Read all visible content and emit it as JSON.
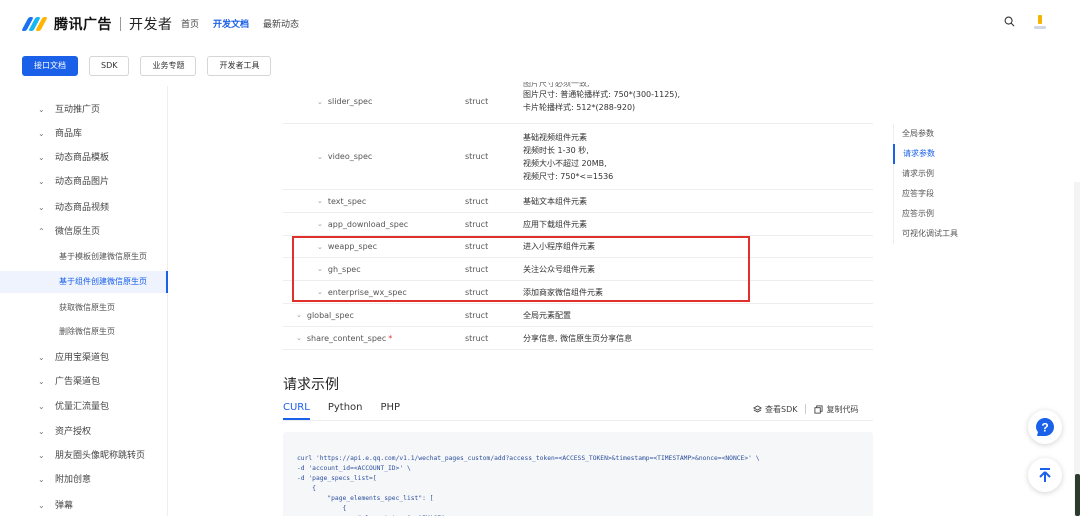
{
  "header": {
    "brand": "腾讯广告",
    "brand_sub": "开发者",
    "nav": [
      {
        "label": "首页"
      },
      {
        "label": "开发文档"
      },
      {
        "label": "最新动态"
      }
    ],
    "active_nav": "开发文档"
  },
  "subnav": {
    "pills": [
      {
        "label": "接口文档"
      },
      {
        "label": "SDK"
      },
      {
        "label": "业务专题"
      },
      {
        "label": "开发者工具"
      }
    ]
  },
  "sidebar": {
    "items": [
      {
        "label": "互动推广页",
        "chev": "⌄"
      },
      {
        "label": "商品库",
        "chev": "⌄"
      },
      {
        "label": "动态商品模板",
        "chev": "⌄"
      },
      {
        "label": "动态商品图片",
        "chev": "⌄"
      },
      {
        "label": "动态商品视频",
        "chev": "⌄"
      },
      {
        "label": "微信原生页",
        "chev": "⌃"
      },
      {
        "label": "应用宝渠道包",
        "chev": "⌄"
      },
      {
        "label": "广告渠道包",
        "chev": "⌄"
      },
      {
        "label": "优量汇流量包",
        "chev": "⌄"
      },
      {
        "label": "资产授权",
        "chev": "⌄"
      },
      {
        "label": "朋友圈头像昵称跳转页",
        "chev": "⌄"
      },
      {
        "label": "附加创意",
        "chev": "⌄"
      },
      {
        "label": "弹幕",
        "chev": "⌄"
      }
    ],
    "subitems": [
      {
        "label": "基于模板创建微信原生页"
      },
      {
        "label": "基于组件创建微信原生页"
      },
      {
        "label": "获取微信原生页"
      },
      {
        "label": "删除微信原生页"
      }
    ]
  },
  "params": {
    "rows": [
      {
        "name": "slider_spec",
        "type": "struct",
        "desc": [
          "图片尺寸: 普通轮播样式: 750*(300-1125),",
          "卡片轮播样式: 512*(288-920)"
        ],
        "level": 2
      },
      {
        "name": "video_spec",
        "type": "struct",
        "desc": [
          "基础视频组件元素",
          "视频时长 1-30 秒,",
          "视频大小不超过 20MB,",
          "视频尺寸: 750*<=1536"
        ],
        "level": 2
      },
      {
        "name": "text_spec",
        "type": "struct",
        "desc": [
          "基础文本组件元素"
        ],
        "level": 2
      },
      {
        "name": "app_download_spec",
        "type": "struct",
        "desc": [
          "应用下载组件元素"
        ],
        "level": 2
      },
      {
        "name": "weapp_spec",
        "type": "struct",
        "desc": [
          "进入小程序组件元素"
        ],
        "level": 2
      },
      {
        "name": "gh_spec",
        "type": "struct",
        "desc": [
          "关注公众号组件元素"
        ],
        "level": 2
      },
      {
        "name": "enterprise_wx_spec",
        "type": "struct",
        "desc": [
          "添加商家微信组件元素"
        ],
        "level": 2
      },
      {
        "name": "global_spec",
        "type": "struct",
        "desc": [
          "全局元素配置"
        ],
        "level": 1
      },
      {
        "name": "share_content_spec",
        "type": "struct",
        "desc": [
          "分享信息, 微信原生页分享信息"
        ],
        "level": 1,
        "required": "*"
      }
    ],
    "clipped_top_line": "图片尺寸必须一致,"
  },
  "request_example": {
    "title": "请求示例",
    "tabs": [
      {
        "label": "CURL"
      },
      {
        "label": "Python"
      },
      {
        "label": "PHP"
      }
    ],
    "view_sdk": "查看SDK",
    "copy_code": "复制代码",
    "code": "curl 'https://api.e.qq.com/v1.1/wechat_pages_custom/add?access_token=<ACCESS_TOKEN>&timestamp=<TIMESTAMP>&nonce=<NONCE>' \\\n-d 'account_id=<ACCOUNT_ID>' \\\n-d 'page_specs_list=[\n    {\n        \"page_elements_spec_list\": [\n            {\n                \"element_type\": \"IMAGE\","
  },
  "toc": {
    "items": [
      {
        "label": "全局参数"
      },
      {
        "label": "请求参数"
      },
      {
        "label": "请求示例"
      },
      {
        "label": "应答字段"
      },
      {
        "label": "应答示例"
      },
      {
        "label": "可视化调试工具"
      }
    ]
  },
  "colors": {
    "accent": "#1a60e8",
    "highlight": "#e0302c"
  }
}
